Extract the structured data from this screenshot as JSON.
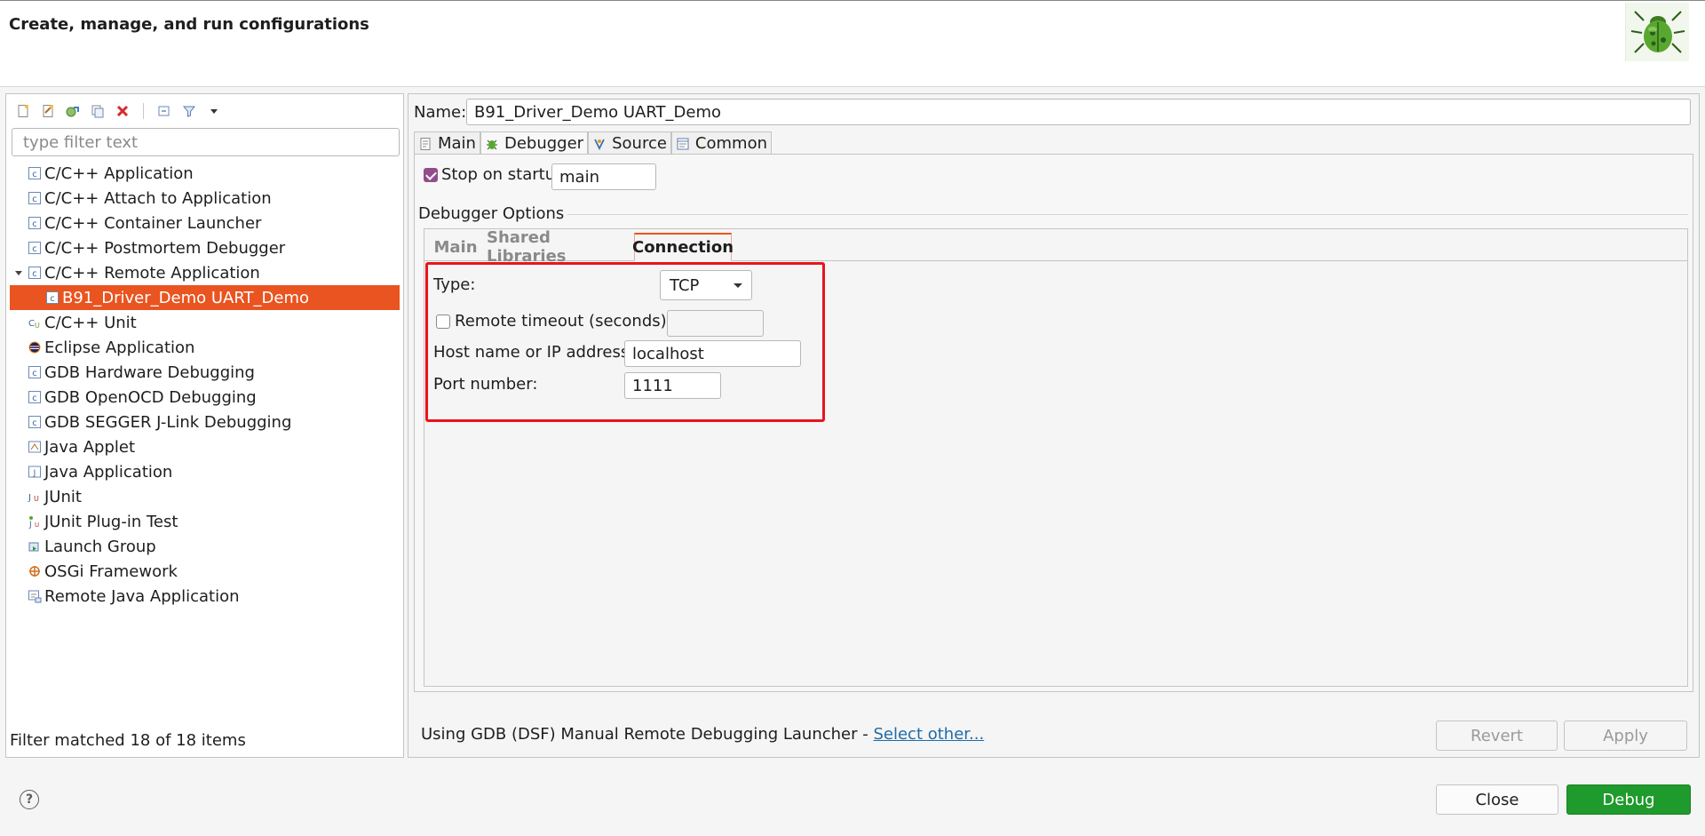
{
  "header": {
    "title": "Create, manage, and run configurations",
    "logo_icon": "bug-icon"
  },
  "left": {
    "toolbar": [
      {
        "name": "new-config-icon"
      },
      {
        "name": "new-prototype-icon"
      },
      {
        "name": "export-icon"
      },
      {
        "name": "duplicate-icon"
      },
      {
        "name": "delete-icon"
      },
      {
        "name": "collapse-all-icon"
      },
      {
        "name": "filter-icon"
      },
      {
        "name": "view-menu-icon"
      }
    ],
    "filter_placeholder": "type filter text",
    "tree": [
      {
        "label": "C/C++ Application",
        "icon": "c-icon"
      },
      {
        "label": "C/C++ Attach to Application",
        "icon": "c-icon"
      },
      {
        "label": "C/C++ Container Launcher",
        "icon": "c-icon"
      },
      {
        "label": "C/C++ Postmortem Debugger",
        "icon": "c-icon"
      },
      {
        "label": "C/C++ Remote Application",
        "icon": "c-icon",
        "expanded": true
      },
      {
        "label": "B91_Driver_Demo UART_Demo",
        "icon": "c-icon",
        "child": true,
        "selected": true
      },
      {
        "label": "C/C++ Unit",
        "icon": "cu-icon"
      },
      {
        "label": "Eclipse Application",
        "icon": "eclipse-icon"
      },
      {
        "label": "GDB Hardware Debugging",
        "icon": "c-icon"
      },
      {
        "label": "GDB OpenOCD Debugging",
        "icon": "c-icon"
      },
      {
        "label": "GDB SEGGER J-Link Debugging",
        "icon": "c-icon"
      },
      {
        "label": "Java Applet",
        "icon": "applet-icon"
      },
      {
        "label": "Java Application",
        "icon": "java-icon"
      },
      {
        "label": "JUnit",
        "icon": "junit-icon"
      },
      {
        "label": "JUnit Plug-in Test",
        "icon": "junit-plugin-icon"
      },
      {
        "label": "Launch Group",
        "icon": "launch-group-icon"
      },
      {
        "label": "OSGi Framework",
        "icon": "osgi-icon"
      },
      {
        "label": "Remote Java Application",
        "icon": "remote-java-icon"
      }
    ],
    "status": "Filter matched 18 of 18 items"
  },
  "right": {
    "name_label": "Name:",
    "name_value": "B91_Driver_Demo UART_Demo",
    "tabs": [
      {
        "label": "Main",
        "icon": "main-tab-icon"
      },
      {
        "label": "Debugger",
        "icon": "debugger-tab-icon",
        "active": true
      },
      {
        "label": "Source",
        "icon": "source-tab-icon"
      },
      {
        "label": "Common",
        "icon": "common-tab-icon"
      }
    ],
    "stop_on_startup": {
      "label": "Stop on startup at:",
      "checked": true,
      "value": "main"
    },
    "debugger_options_label": "Debugger Options",
    "subtabs": [
      {
        "label": "Main"
      },
      {
        "label": "Shared Libraries"
      },
      {
        "label": "Connection",
        "active": true
      }
    ],
    "connection": {
      "type_label": "Type:",
      "type_value": "TCP",
      "timeout_label": "Remote timeout (seconds):",
      "timeout_checked": false,
      "timeout_value": "",
      "host_label": "Host name or IP address:",
      "host_value": "localhost",
      "port_label": "Port number:",
      "port_value": "1111"
    },
    "launcher_text": "Using GDB (DSF) Manual Remote Debugging Launcher - ",
    "launcher_link": "Select other...",
    "revert_label": "Revert",
    "apply_label": "Apply"
  },
  "footer": {
    "help_icon": "help-icon",
    "help_glyph": "?",
    "close_label": "Close",
    "debug_label": "Debug"
  },
  "colors": {
    "selection": "#e95420",
    "debug_button": "#1f9a2c",
    "highlight_box": "#e8141c",
    "checkbox": "#924d8b",
    "link": "#1f6ba8"
  }
}
